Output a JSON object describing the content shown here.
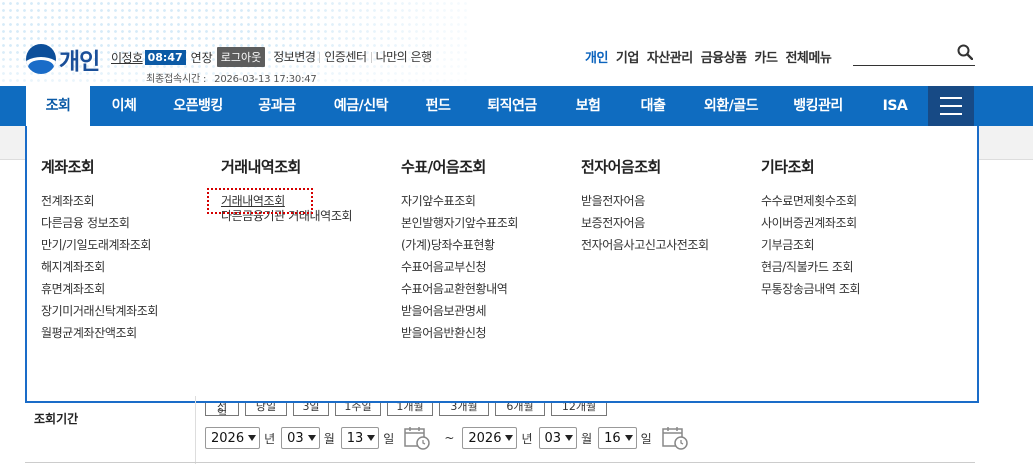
{
  "header": {
    "logo_text": "개인",
    "user_name": "이정호",
    "session_timer": "08:47",
    "extend_label": "연장",
    "logout_label": "로그아웃",
    "user_links": [
      "정보변경",
      "인증센터",
      "나만의 은행"
    ],
    "last_login_label": "최종접속시간 :",
    "last_login_value": "2026-03-13 17:30:47",
    "top_menu": [
      "개인",
      "기업",
      "자산관리",
      "금융상품",
      "카드",
      "전체메뉴"
    ],
    "top_menu_active": "개인"
  },
  "nav": {
    "items": [
      "조회",
      "이체",
      "오픈뱅킹",
      "공과금",
      "예금/신탁",
      "펀드",
      "퇴직연금",
      "보험",
      "대출",
      "외환/골드",
      "뱅킹관리",
      "ISA"
    ],
    "active": "조회"
  },
  "dropdown": {
    "columns": [
      {
        "title": "계좌조회",
        "items": [
          "전계좌조회",
          "다른금융 정보조회",
          "만기/기일도래계좌조회",
          "해지계좌조회",
          "휴면계좌조회",
          "장기미거래신탁계좌조회",
          "월평균계좌잔액조회"
        ]
      },
      {
        "title": "거래내역조회",
        "items": [
          "거래내역조회",
          "다른금융기관 거래내역조회"
        ],
        "highlighted": "거래내역조회"
      },
      {
        "title": "수표/어음조회",
        "items": [
          "자기앞수표조회",
          "본인발행자기앞수표조회",
          "(가계)당좌수표현황",
          "수표어음교부신청",
          "수표어음교환현황내역",
          "받을어음보관명세",
          "받을어음반환신청"
        ]
      },
      {
        "title": "전자어음조회",
        "items": [
          "받을전자어음",
          "보증전자어음",
          "전자어음사고신고사전조회"
        ]
      },
      {
        "title": "기타조회",
        "items": [
          "수수료면제횟수조회",
          "사이버증권계좌조회",
          "기부금조회",
          "현금/직불카드 조회",
          "무통장송금내역 조회"
        ]
      }
    ]
  },
  "form": {
    "period_label": "조회기간",
    "quick_buttons": [
      "전일",
      "당일",
      "3일",
      "1주일",
      "1개월",
      "3개월",
      "6개월",
      "12개월"
    ],
    "from": {
      "year": "2026",
      "month": "03",
      "day": "13"
    },
    "to": {
      "year": "2026",
      "month": "03",
      "day": "16"
    },
    "unit_year": "년",
    "unit_month": "월",
    "unit_day": "일",
    "range_sep": "~"
  },
  "colors": {
    "nav_blue": "#0f6cc0",
    "nav_dark": "#174a85",
    "highlight_red": "#d40000"
  }
}
